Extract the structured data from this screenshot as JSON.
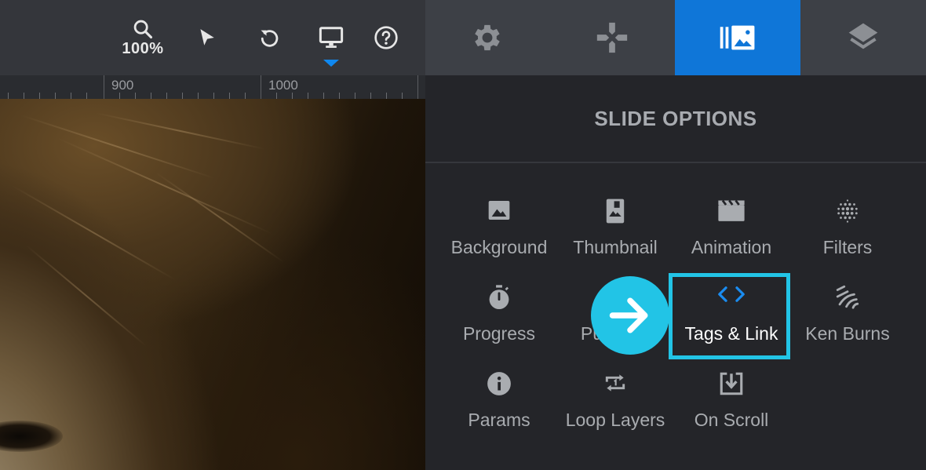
{
  "toolbar": {
    "zoom_level": "100%",
    "tools": [
      "search-icon",
      "cursor-icon",
      "undo-icon",
      "desktop-icon",
      "help-icon"
    ],
    "active_indicator_color": "#0f88f0"
  },
  "ruler": {
    "labels": [
      "900",
      "1000"
    ]
  },
  "tabs": {
    "items": [
      "gear-icon",
      "gamepad-icon",
      "slides-icon",
      "layers-icon"
    ],
    "active_index": 2,
    "active_color": "#0f76d8"
  },
  "panel": {
    "title": "SLIDE OPTIONS",
    "options": [
      {
        "label": "Background",
        "icon": "image-icon"
      },
      {
        "label": "Thumbnail",
        "icon": "thumbnail-icon"
      },
      {
        "label": "Animation",
        "icon": "clapperboard-icon"
      },
      {
        "label": "Filters",
        "icon": "filters-icon"
      },
      {
        "label": "Progress",
        "icon": "stopwatch-icon"
      },
      {
        "label": "Pu",
        "icon": "publish-icon"
      },
      {
        "label": "Tags & Link",
        "icon": "code-icon"
      },
      {
        "label": "Ken Burns",
        "icon": "kenburns-icon"
      },
      {
        "label": "Params",
        "icon": "info-icon"
      },
      {
        "label": "Loop Layers",
        "icon": "repeat-one-icon"
      },
      {
        "label": "On Scroll",
        "icon": "download-box-icon"
      }
    ]
  },
  "highlight": {
    "color": "#22c4e6",
    "target": "Tags & Link"
  }
}
